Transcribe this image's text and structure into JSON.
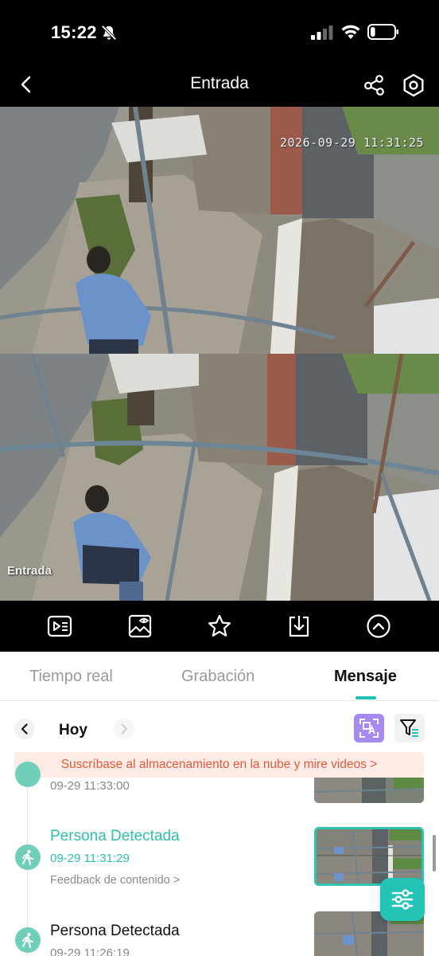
{
  "status_bar": {
    "time": "15:22",
    "icons": [
      "bell-off-icon",
      "signal-icon",
      "wifi-icon",
      "battery-icon"
    ],
    "battery_level": 0.2
  },
  "nav": {
    "title": "Entrada",
    "icons": [
      "back-icon",
      "share-icon",
      "settings-icon"
    ]
  },
  "feed": {
    "timestamp": "2026-09-29 11:31:25",
    "camera_label": "Entrada"
  },
  "toolbar": {
    "icons": [
      "video-list-icon",
      "image-view-icon",
      "star-icon",
      "download-icon",
      "chevron-up-icon"
    ]
  },
  "tabs": [
    {
      "label": "Tiempo real",
      "active": false
    },
    {
      "label": "Grabación",
      "active": false
    },
    {
      "label": "Mensaje",
      "active": true
    }
  ],
  "date_nav": {
    "label": "Hoy",
    "icons": [
      "chevron-left-icon",
      "chevron-right-icon",
      "scan-translate-icon",
      "filter-icon"
    ]
  },
  "cloud_banner": "Suscríbase al almacenamiento en la nube y mire videos >",
  "events": [
    {
      "title": "",
      "time": "09-29 11:33:00",
      "feedback": "",
      "selected": false
    },
    {
      "title": "Persona Detectada",
      "time": "09-29 11:31:29",
      "feedback": "Feedback de contenido >",
      "selected": true
    },
    {
      "title": "Persona Detectada",
      "time": "09-29 11:26:19",
      "feedback": "",
      "selected": false
    }
  ],
  "fab": {
    "icon": "sliders-icon"
  },
  "colors": {
    "accent": "#23c3b6",
    "banner_text": "#e35a3a",
    "banner_bg": "#fdebe6",
    "scan_button": "#a58af0"
  }
}
